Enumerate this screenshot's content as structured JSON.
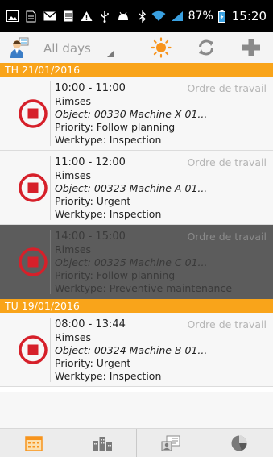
{
  "status_bar": {
    "battery": "87%",
    "time": "15:20",
    "icons": [
      "image-icon",
      "document-icon",
      "mail-icon",
      "notes-icon",
      "warning-icon",
      "usb-icon",
      "android-icon",
      "bluetooth-icon",
      "wifi-icon",
      "signal-icon",
      "battery-icon"
    ]
  },
  "toolbar": {
    "filter_value": "All days",
    "icons": [
      "user-icon",
      "sun-icon",
      "sync-icon",
      "add-icon"
    ]
  },
  "sections": [
    {
      "header": "TH 21/01/2016",
      "items": [
        {
          "time": "10:00 - 11:00",
          "type": "Ordre de travail",
          "name": "Rimses",
          "object": "Object: 00330 Machine X 01...",
          "priority": "Priority: Follow planning",
          "werktype": "Werktype: Inspection"
        },
        {
          "time": "11:00 - 12:00",
          "type": "Ordre de travail",
          "name": "Rimses",
          "object": "Object: 00323 Machine A 01...",
          "priority": "Priority: Urgent",
          "werktype": "Werktype: Inspection"
        },
        {
          "time": "14:00 - 15:00",
          "type": "Ordre de travail",
          "name": "Rimses",
          "object": "Object: 00325 Machine C 01...",
          "priority": "Priority: Follow planning",
          "werktype": "Werktype: Preventive maintenance",
          "selected": true
        }
      ]
    },
    {
      "header": "TU 19/01/2016",
      "items": [
        {
          "time": "08:00 - 13:44",
          "type": "Ordre de travail",
          "name": "Rimses",
          "object": "Object: 00324 Machine B 01...",
          "priority": "Priority: Urgent",
          "werktype": "Werktype: Inspection"
        }
      ]
    }
  ],
  "bottom_nav": {
    "icons": [
      "calendar-icon",
      "buildings-icon",
      "id-card-icon",
      "pie-chart-icon"
    ]
  },
  "colors": {
    "accent": "#f9a41a",
    "stop_red": "#d6202a",
    "selected_bg": "#5c5c5c",
    "sun": "#f7941d"
  }
}
